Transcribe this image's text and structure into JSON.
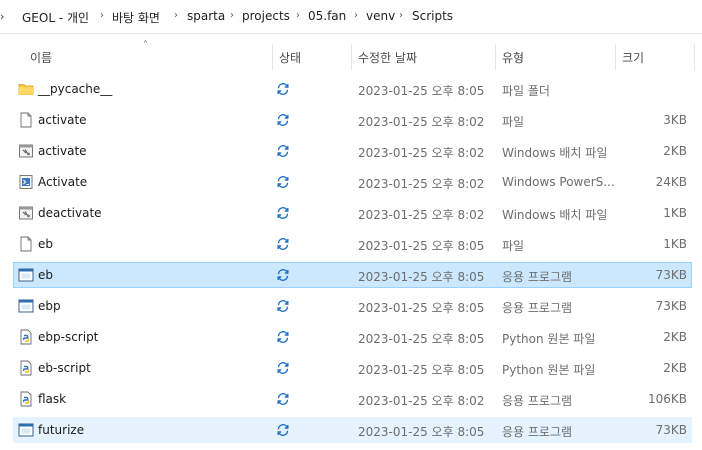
{
  "breadcrumb": [
    "GEOL - 개인",
    "바탕 화면",
    "sparta",
    "projects",
    "05.fan",
    "venv",
    "Scripts"
  ],
  "columns": {
    "name": "이름",
    "status": "상태",
    "modified": "수정한 날짜",
    "type": "유형",
    "size": "크기"
  },
  "colors": {
    "selected_bg": "#cce8ff",
    "selected_border": "#99d1ff",
    "hover_bg": "#e5f3ff",
    "sync_icon": "#1a6fc9",
    "folder": "#f4c445"
  },
  "files": [
    {
      "name": "__pycache__",
      "icon": "folder-icon",
      "date": "2023-01-25 오후 8:05",
      "type": "파일 폴더",
      "size": ""
    },
    {
      "name": "activate",
      "icon": "file-icon",
      "date": "2023-01-25 오후 8:02",
      "type": "파일",
      "size": "3KB"
    },
    {
      "name": "activate",
      "icon": "batch-file-icon",
      "date": "2023-01-25 오후 8:02",
      "type": "Windows 배치 파일",
      "size": "2KB"
    },
    {
      "name": "Activate",
      "icon": "powershell-script-icon",
      "date": "2023-01-25 오후 8:02",
      "type": "Windows PowerS...",
      "size": "24KB"
    },
    {
      "name": "deactivate",
      "icon": "batch-file-icon",
      "date": "2023-01-25 오후 8:02",
      "type": "Windows 배치 파일",
      "size": "1KB"
    },
    {
      "name": "eb",
      "icon": "file-icon",
      "date": "2023-01-25 오후 8:05",
      "type": "파일",
      "size": "1KB"
    },
    {
      "name": "eb",
      "icon": "application-icon",
      "date": "2023-01-25 오후 8:05",
      "type": "응용 프로그램",
      "size": "73KB"
    },
    {
      "name": "ebp",
      "icon": "application-icon",
      "date": "2023-01-25 오후 8:05",
      "type": "응용 프로그램",
      "size": "73KB"
    },
    {
      "name": "ebp-script",
      "icon": "python-file-icon",
      "date": "2023-01-25 오후 8:05",
      "type": "Python 원본 파일",
      "size": "2KB"
    },
    {
      "name": "eb-script",
      "icon": "python-file-icon",
      "date": "2023-01-25 오후 8:05",
      "type": "Python 원본 파일",
      "size": "2KB"
    },
    {
      "name": "flask",
      "icon": "python-file-icon",
      "date": "2023-01-25 오후 8:02",
      "type": "응용 프로그램",
      "size": "106KB"
    },
    {
      "name": "futurize",
      "icon": "application-icon",
      "date": "2023-01-25 오후 8:05",
      "type": "응용 프로그램",
      "size": "73KB"
    }
  ],
  "selected_index": 6,
  "hover_index": 11
}
